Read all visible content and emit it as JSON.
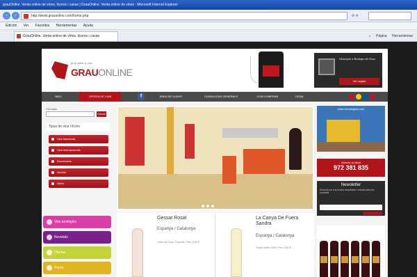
{
  "browser": {
    "window_title": "grauOnline. Venta online de vinos, licores i cavas | GrauOnline. Venta online de vinos - Microsoft Internet Explorer",
    "url": "http://www.grauonline.com/home.php",
    "menu": [
      "Edición",
      "Ver",
      "Favoritos",
      "Herramientas",
      "Ayuda"
    ],
    "tab_title": "GrauOnline. Venta online de vinos, licores i cavas",
    "command_bar": [
      "Página",
      "Herramientas"
    ]
  },
  "site": {
    "logo_sub": "grup celler & vins",
    "logo_main": "GRAU",
    "logo_online": "ONLINE",
    "gift_text": "Obsequio a Bodega del Grau",
    "gift_button": "Ver regalo",
    "nav": [
      {
        "label": "INICI",
        "active": false
      },
      {
        "label": "OFERTA DE VINS",
        "active": true
      },
      {
        "label": "ÀREA DE CLIENT",
        "active": false
      },
      {
        "label": "CONDICIONS GENERALS",
        "active": false
      },
      {
        "label": "COM COMPRAR",
        "active": false
      },
      {
        "label": "LEGAL",
        "active": false
      }
    ],
    "flag_colors": [
      "#c8102e",
      "#ffcc00",
      "#0055a4",
      "#c8102e"
    ],
    "search_label": "Cercador",
    "search_button": "Cercar",
    "sidebar_heading": "Tipus de vins i licors",
    "categories": [
      "Vins Nacionals",
      "Vins Internacionals",
      "Escumosos",
      "Alcohol",
      "Altres"
    ],
    "promos": [
      {
        "label": "Vins ecològics",
        "color": "#d93fa6"
      },
      {
        "label": "Novetats",
        "color": "#7a1f8e"
      },
      {
        "label": "Ofertes",
        "color": "#c6d23a"
      },
      {
        "label": "Packs",
        "color": "#e0b321"
      }
    ],
    "building_caption": "www.vinsdelgrau.com",
    "phone_label": "Atenció al client",
    "phone_number": "972 381 835",
    "newsletter_title": "Newsletter",
    "newsletter_text": "Subscriu-te a la nostra newsletter i rebràs totes les novetats",
    "products": [
      {
        "title": "Gessat Rosat",
        "origin": "Espanya / Catalunya",
        "detail": "Celler del Grau. Empordà. Preu: 6,50 €",
        "bottle": "rose"
      },
      {
        "title": "La Canya De Fuera Sandra",
        "origin": "Espanya / Catalunya",
        "detail": "Vinyes Velles 2009. Preu: 9,90 €",
        "bottle": "white"
      }
    ]
  }
}
